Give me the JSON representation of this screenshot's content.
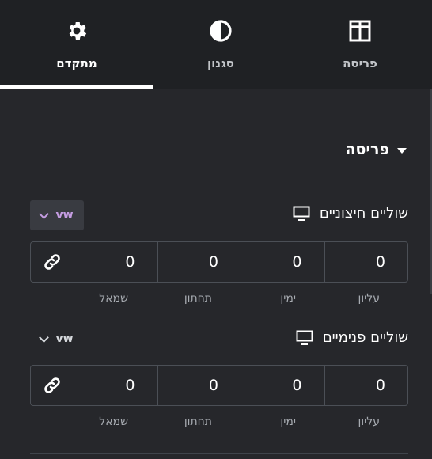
{
  "tabs": [
    {
      "label": "מתקדם",
      "icon": "gear-icon",
      "active": true
    },
    {
      "label": "סגנון",
      "icon": "contrast-icon",
      "active": false
    },
    {
      "label": "פריסה",
      "icon": "layout-columns-icon",
      "active": false
    }
  ],
  "section": {
    "title": "פריסה"
  },
  "margin": {
    "label": "שוליים חיצוניים",
    "unit": "vw",
    "values": [
      "0",
      "0",
      "0",
      "0"
    ],
    "sides": [
      "שמאל",
      "תחתון",
      "ימין",
      "עליון"
    ]
  },
  "padding": {
    "label": "שוליים פנימיים",
    "unit": "vw",
    "values": [
      "0",
      "0",
      "0",
      "0"
    ],
    "sides": [
      "שמאל",
      "תחתון",
      "ימין",
      "עליון"
    ]
  },
  "colors": {
    "accent_unit": "#c59de2",
    "background": "#26272b",
    "header": "#1f2124"
  }
}
